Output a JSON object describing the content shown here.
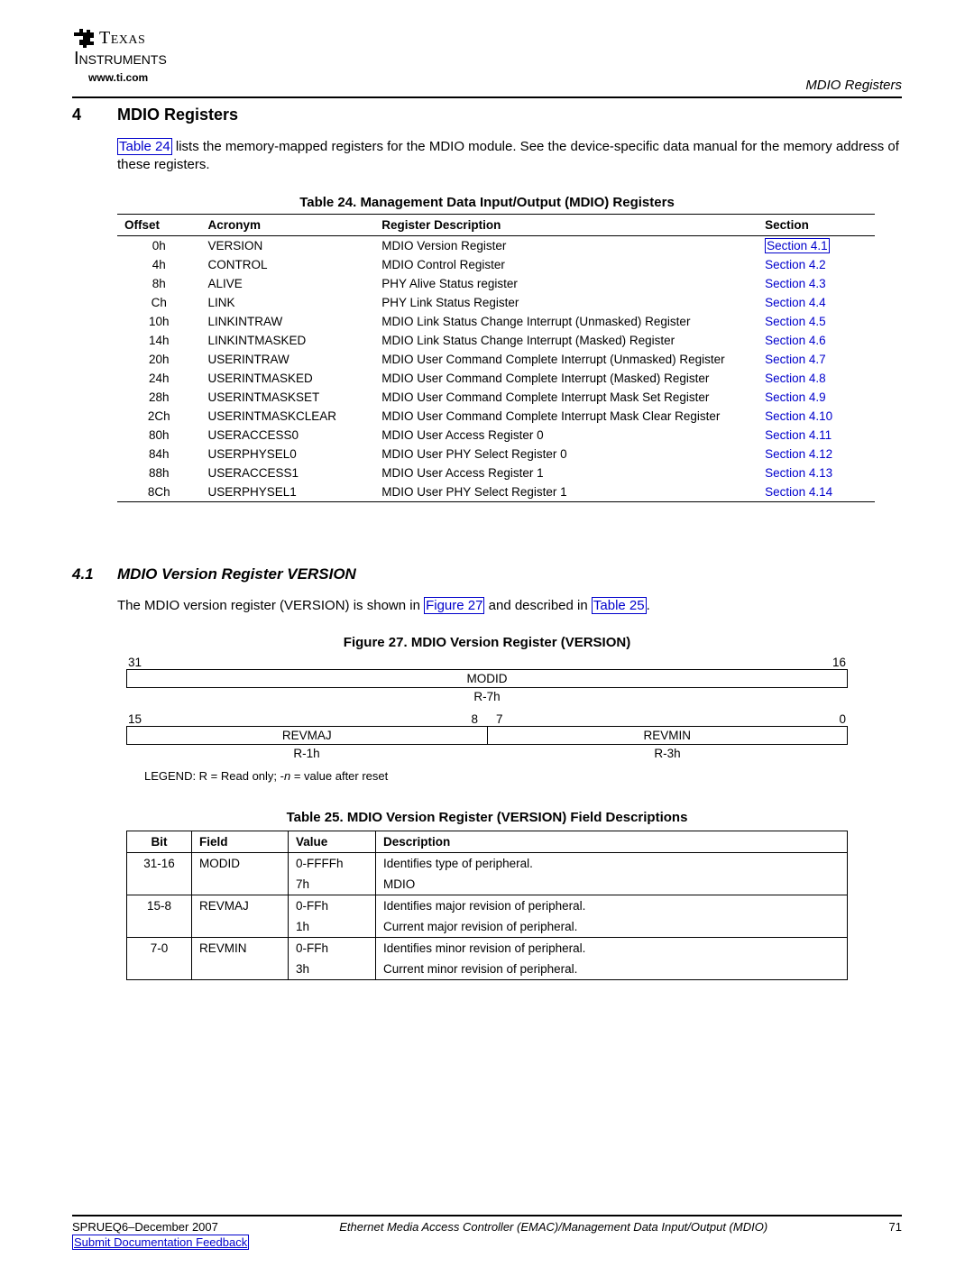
{
  "header": {
    "logo_text1": "Texas",
    "logo_text2": "Instruments",
    "url": "www.ti.com",
    "right": "MDIO Registers"
  },
  "section": {
    "number": "4",
    "title": "MDIO Registers"
  },
  "para1_a": "Table 24",
  "para1_b": " lists the memory-mapped registers for the MDIO module. See the device-specific data manual for the memory address of these registers.",
  "table24_caption": "Table 24. Management Data Input/Output (MDIO) Registers",
  "table24_headers": {
    "offset": "Offset",
    "acronym": "Acronym",
    "desc": "Register Description",
    "section": "Section"
  },
  "table24_rows": [
    {
      "offset": "0h",
      "acronym": "VERSION",
      "desc": "MDIO Version Register",
      "section": "Section 4.1",
      "box": true
    },
    {
      "offset": "4h",
      "acronym": "CONTROL",
      "desc": "MDIO Control Register",
      "section": "Section 4.2"
    },
    {
      "offset": "8h",
      "acronym": "ALIVE",
      "desc": "PHY Alive Status register",
      "section": "Section 4.3"
    },
    {
      "offset": "Ch",
      "acronym": "LINK",
      "desc": "PHY Link Status Register",
      "section": "Section 4.4"
    },
    {
      "offset": "10h",
      "acronym": "LINKINTRAW",
      "desc": "MDIO Link Status Change Interrupt (Unmasked) Register",
      "section": "Section 4.5"
    },
    {
      "offset": "14h",
      "acronym": "LINKINTMASKED",
      "desc": "MDIO Link Status Change Interrupt (Masked) Register",
      "section": "Section 4.6"
    },
    {
      "offset": "20h",
      "acronym": "USERINTRAW",
      "desc": "MDIO User Command Complete Interrupt (Unmasked) Register",
      "section": "Section 4.7"
    },
    {
      "offset": "24h",
      "acronym": "USERINTMASKED",
      "desc": "MDIO User Command Complete Interrupt (Masked) Register",
      "section": "Section 4.8"
    },
    {
      "offset": "28h",
      "acronym": "USERINTMASKSET",
      "desc": "MDIO User Command Complete Interrupt Mask Set Register",
      "section": "Section 4.9"
    },
    {
      "offset": "2Ch",
      "acronym": "USERINTMASKCLEAR",
      "desc": "MDIO User Command Complete Interrupt Mask Clear Register",
      "section": "Section 4.10"
    },
    {
      "offset": "80h",
      "acronym": "USERACCESS0",
      "desc": "MDIO User Access Register 0",
      "section": "Section 4.11"
    },
    {
      "offset": "84h",
      "acronym": "USERPHYSEL0",
      "desc": "MDIO User PHY Select Register 0",
      "section": "Section 4.12"
    },
    {
      "offset": "88h",
      "acronym": "USERACCESS1",
      "desc": "MDIO User Access Register 1",
      "section": "Section 4.13"
    },
    {
      "offset": "8Ch",
      "acronym": "USERPHYSEL1",
      "desc": "MDIO User PHY Select Register 1",
      "section": "Section 4.14"
    }
  ],
  "subsection": {
    "number": "4.1",
    "title": "MDIO Version Register VERSION"
  },
  "para2_a": "The MDIO version register (VERSION) is shown in ",
  "para2_link1": "Figure 27",
  "para2_b": " and described in ",
  "para2_link2": "Table 25",
  "para2_c": ".",
  "fig27_caption": "Figure 27. MDIO Version Register (VERSION)",
  "reg": {
    "b31": "31",
    "b16": "16",
    "b15": "15",
    "b8": "8",
    "b7": "7",
    "b0": "0",
    "modid": "MODID",
    "r7h": "R-7h",
    "revmaj": "REVMAJ",
    "r1h": "R-1h",
    "revmin": "REVMIN",
    "r3h": "R-3h"
  },
  "legend_prefix": "LEGEND: R = Read only; -",
  "legend_n": "n",
  "legend_suffix": " = value after reset",
  "table25_caption": "Table 25. MDIO Version Register (VERSION) Field Descriptions",
  "table25_headers": {
    "bit": "Bit",
    "field": "Field",
    "value": "Value",
    "desc": "Description"
  },
  "table25_rows": [
    {
      "bit": "31-16",
      "field": "MODID",
      "value": "0-FFFFh",
      "desc": "Identifies type of peripheral."
    },
    {
      "bit": "",
      "field": "",
      "value": "7h",
      "desc": "MDIO"
    },
    {
      "bit": "15-8",
      "field": "REVMAJ",
      "value": "0-FFh",
      "desc": "Identifies major revision of peripheral."
    },
    {
      "bit": "",
      "field": "",
      "value": "1h",
      "desc": "Current major revision of peripheral."
    },
    {
      "bit": "7-0",
      "field": "REVMIN",
      "value": "0-FFh",
      "desc": "Identifies minor revision of peripheral."
    },
    {
      "bit": "",
      "field": "",
      "value": "3h",
      "desc": "Current minor revision of peripheral."
    }
  ],
  "footer": {
    "left": "SPRUEQ6–December 2007",
    "center": "Ethernet Media Access Controller (EMAC)/Management Data Input/Output (MDIO)",
    "right": "71",
    "link": "Submit Documentation Feedback"
  }
}
